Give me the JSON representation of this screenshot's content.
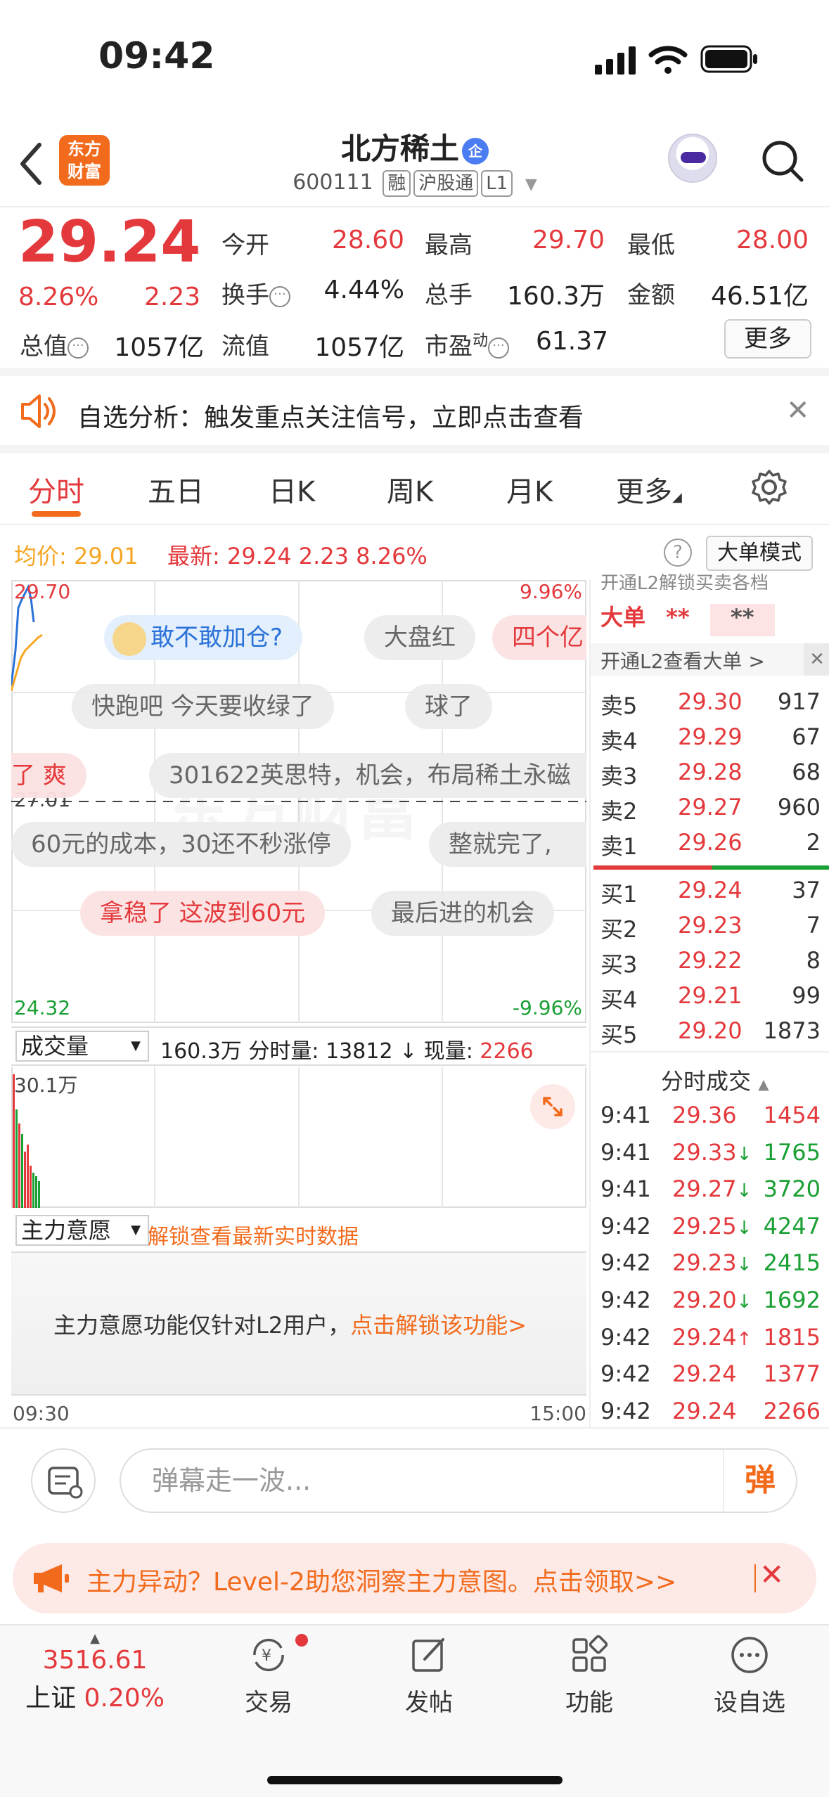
{
  "status_bar": {
    "time": "09:42"
  },
  "header": {
    "back_icon": "chevron-left-icon",
    "logo_line1": "东方",
    "logo_line2": "财富",
    "stock_name": "北方稀土",
    "stock_badge": "企",
    "stock_code": "600111",
    "tags": [
      "融",
      "沪股通",
      "L1"
    ]
  },
  "quote": {
    "price": "29.24",
    "change_pct": "8.26%",
    "change_amt": "2.23",
    "fields": {
      "open_label": "今开",
      "open": "28.60",
      "high_label": "最高",
      "high": "29.70",
      "low_label": "最低",
      "low": "28.00",
      "turnover_label": "换手",
      "turnover": "4.44%",
      "volume_label": "总手",
      "volume": "160.3万",
      "amount_label": "金额",
      "amount": "46.51亿",
      "mktcap_label": "总值",
      "mktcap": "1057亿",
      "float_label": "流值",
      "float": "1057亿",
      "pe_label": "市盈",
      "pe_sup": "动",
      "pe": "61.37"
    },
    "more_button": "更多"
  },
  "notice": {
    "text": "自选分析：触发重点关注信号，立即点击查看"
  },
  "tabs": [
    {
      "label": "分时",
      "active": true
    },
    {
      "label": "五日"
    },
    {
      "label": "日K"
    },
    {
      "label": "周K"
    },
    {
      "label": "月K"
    },
    {
      "label": "更多"
    }
  ],
  "info_bar": {
    "avg_label": "均价:",
    "avg": "29.01",
    "latest_label": "最新:",
    "latest": "29.24",
    "latest_chg": "2.23",
    "latest_pct": "8.26%",
    "big_order_mode": "大单模式"
  },
  "chart": {
    "y_top": "29.70",
    "y_top_pct": "9.96%",
    "y_mid": "27.01",
    "y_bottom": "24.32",
    "y_bottom_pct": "-9.96%",
    "danmu": [
      "敢不敢加仓?",
      "大盘红",
      "四个亿",
      "快跑吧 今天要收绿了",
      "球了",
      "了 爽",
      "301622英思特，机会，布局稀土永磁",
      "60元的成本，30还不秒涨停",
      "整就完了,",
      "拿稳了 这波到60元",
      "最后进的机会"
    ],
    "watermark": "东方财富"
  },
  "volume": {
    "selector": "成交量",
    "total": "160.3万",
    "minute_label": "分时量:",
    "minute": "13812",
    "current_label": "现量:",
    "current": "2266",
    "max_label": "30.1万"
  },
  "main_force": {
    "selector": "主力意愿",
    "unlock_link": "解锁查看最新实时数据",
    "lock_text": "主力意愿功能仅针对L2用户，",
    "lock_link": "点击解锁该功能>"
  },
  "time_axis": {
    "start": "09:30",
    "end": "15:00"
  },
  "order_book": {
    "banner_top": "开通L2解锁买卖各档",
    "big_order_label": "大单",
    "big_order_val1": "**",
    "big_order_val2": "**",
    "l2_link": "开通L2查看大单 >",
    "asks": [
      {
        "label": "卖5",
        "price": "29.30",
        "vol": "917"
      },
      {
        "label": "卖4",
        "price": "29.29",
        "vol": "67"
      },
      {
        "label": "卖3",
        "price": "29.28",
        "vol": "68"
      },
      {
        "label": "卖2",
        "price": "29.27",
        "vol": "960"
      },
      {
        "label": "卖1",
        "price": "29.26",
        "vol": "2"
      }
    ],
    "bids": [
      {
        "label": "买1",
        "price": "29.24",
        "vol": "37"
      },
      {
        "label": "买2",
        "price": "29.23",
        "vol": "7"
      },
      {
        "label": "买3",
        "price": "29.22",
        "vol": "8"
      },
      {
        "label": "买4",
        "price": "29.21",
        "vol": "99"
      },
      {
        "label": "买5",
        "price": "29.20",
        "vol": "1873"
      }
    ],
    "trades_title": "分时成交",
    "trades": [
      {
        "time": "9:41",
        "price": "29.36",
        "arrow": "",
        "vol": "1454",
        "dir": "up"
      },
      {
        "time": "9:41",
        "price": "29.33",
        "arrow": "↓",
        "vol": "1765",
        "dir": "down"
      },
      {
        "time": "9:41",
        "price": "29.27",
        "arrow": "↓",
        "vol": "3720",
        "dir": "down"
      },
      {
        "time": "9:42",
        "price": "29.25",
        "arrow": "↓",
        "vol": "4247",
        "dir": "down"
      },
      {
        "time": "9:42",
        "price": "29.23",
        "arrow": "↓",
        "vol": "2415",
        "dir": "down"
      },
      {
        "time": "9:42",
        "price": "29.20",
        "arrow": "↓",
        "vol": "1692",
        "dir": "down"
      },
      {
        "time": "9:42",
        "price": "29.24",
        "arrow": "↑",
        "vol": "1815",
        "dir": "up"
      },
      {
        "time": "9:42",
        "price": "29.24",
        "arrow": "",
        "vol": "1377",
        "dir": "up"
      },
      {
        "time": "9:42",
        "price": "29.24",
        "arrow": "",
        "vol": "2266",
        "dir": "up"
      }
    ]
  },
  "comment_bar": {
    "placeholder": "弹幕走一波...",
    "send_label": "弹"
  },
  "promo": {
    "text": "主力异动？Level-2助您洞察主力意图。点击领取>>"
  },
  "bottom_nav": {
    "index_value": "3516.61",
    "index_name": "上证",
    "index_pct": "0.20%",
    "items": [
      {
        "label": "交易",
        "icon": "yuan-refresh-icon"
      },
      {
        "label": "发帖",
        "icon": "edit-icon"
      },
      {
        "label": "功能",
        "icon": "grid-icon"
      },
      {
        "label": "设自选",
        "icon": "more-circle-icon"
      }
    ]
  },
  "colors": {
    "up": "#e4393c",
    "down": "#1aa034",
    "accent": "#f26b1d",
    "avg_line": "#f5a623"
  }
}
